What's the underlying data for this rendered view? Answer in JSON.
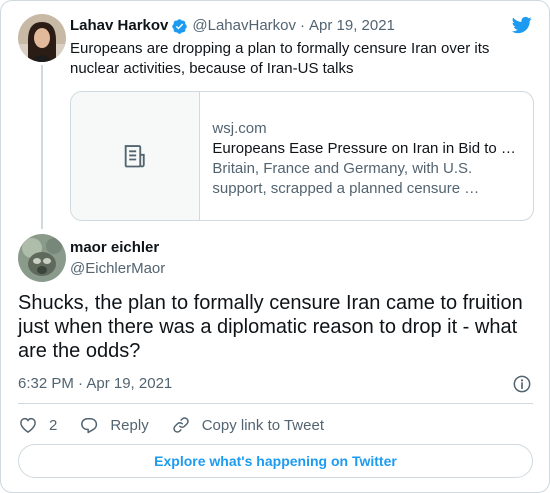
{
  "quoted_tweet": {
    "author_name": "Lahav Harkov",
    "handle": "@LahavHarkov",
    "separator": "·",
    "date": "Apr 19, 2021",
    "text": "Europeans are dropping a plan to formally censure Iran over its nuclear activities, because of Iran-US talks",
    "link_card": {
      "domain": "wsj.com",
      "title": "Europeans Ease Pressure on Iran in Bid to …",
      "description_line1": "Britain, France and Germany, with U.S.",
      "description_line2": "support, scrapped a planned censure …"
    }
  },
  "reply_tweet": {
    "author_name": "maor eichler",
    "handle": "@EichlerMaor",
    "text_line1": "Shucks, the plan to formally censure Iran came to fruition",
    "text_line2": "just when there was a diplomatic reason to drop it - what",
    "text_line3": "are the odds?",
    "timestamp": "6:32 PM · Apr 19, 2021"
  },
  "actions": {
    "like_count": "2",
    "reply_label": "Reply",
    "copy_link_label": "Copy link to Tweet"
  },
  "explore_label": "Explore what's happening on Twitter",
  "colors": {
    "twitter_blue": "#1d9bf0",
    "text_primary": "#0f1419",
    "text_secondary": "#536471",
    "border": "#cfd9de"
  },
  "icons": [
    "twitter-bird-icon",
    "verified-badge-icon",
    "article-icon",
    "info-icon",
    "heart-icon",
    "reply-icon",
    "link-icon"
  ]
}
